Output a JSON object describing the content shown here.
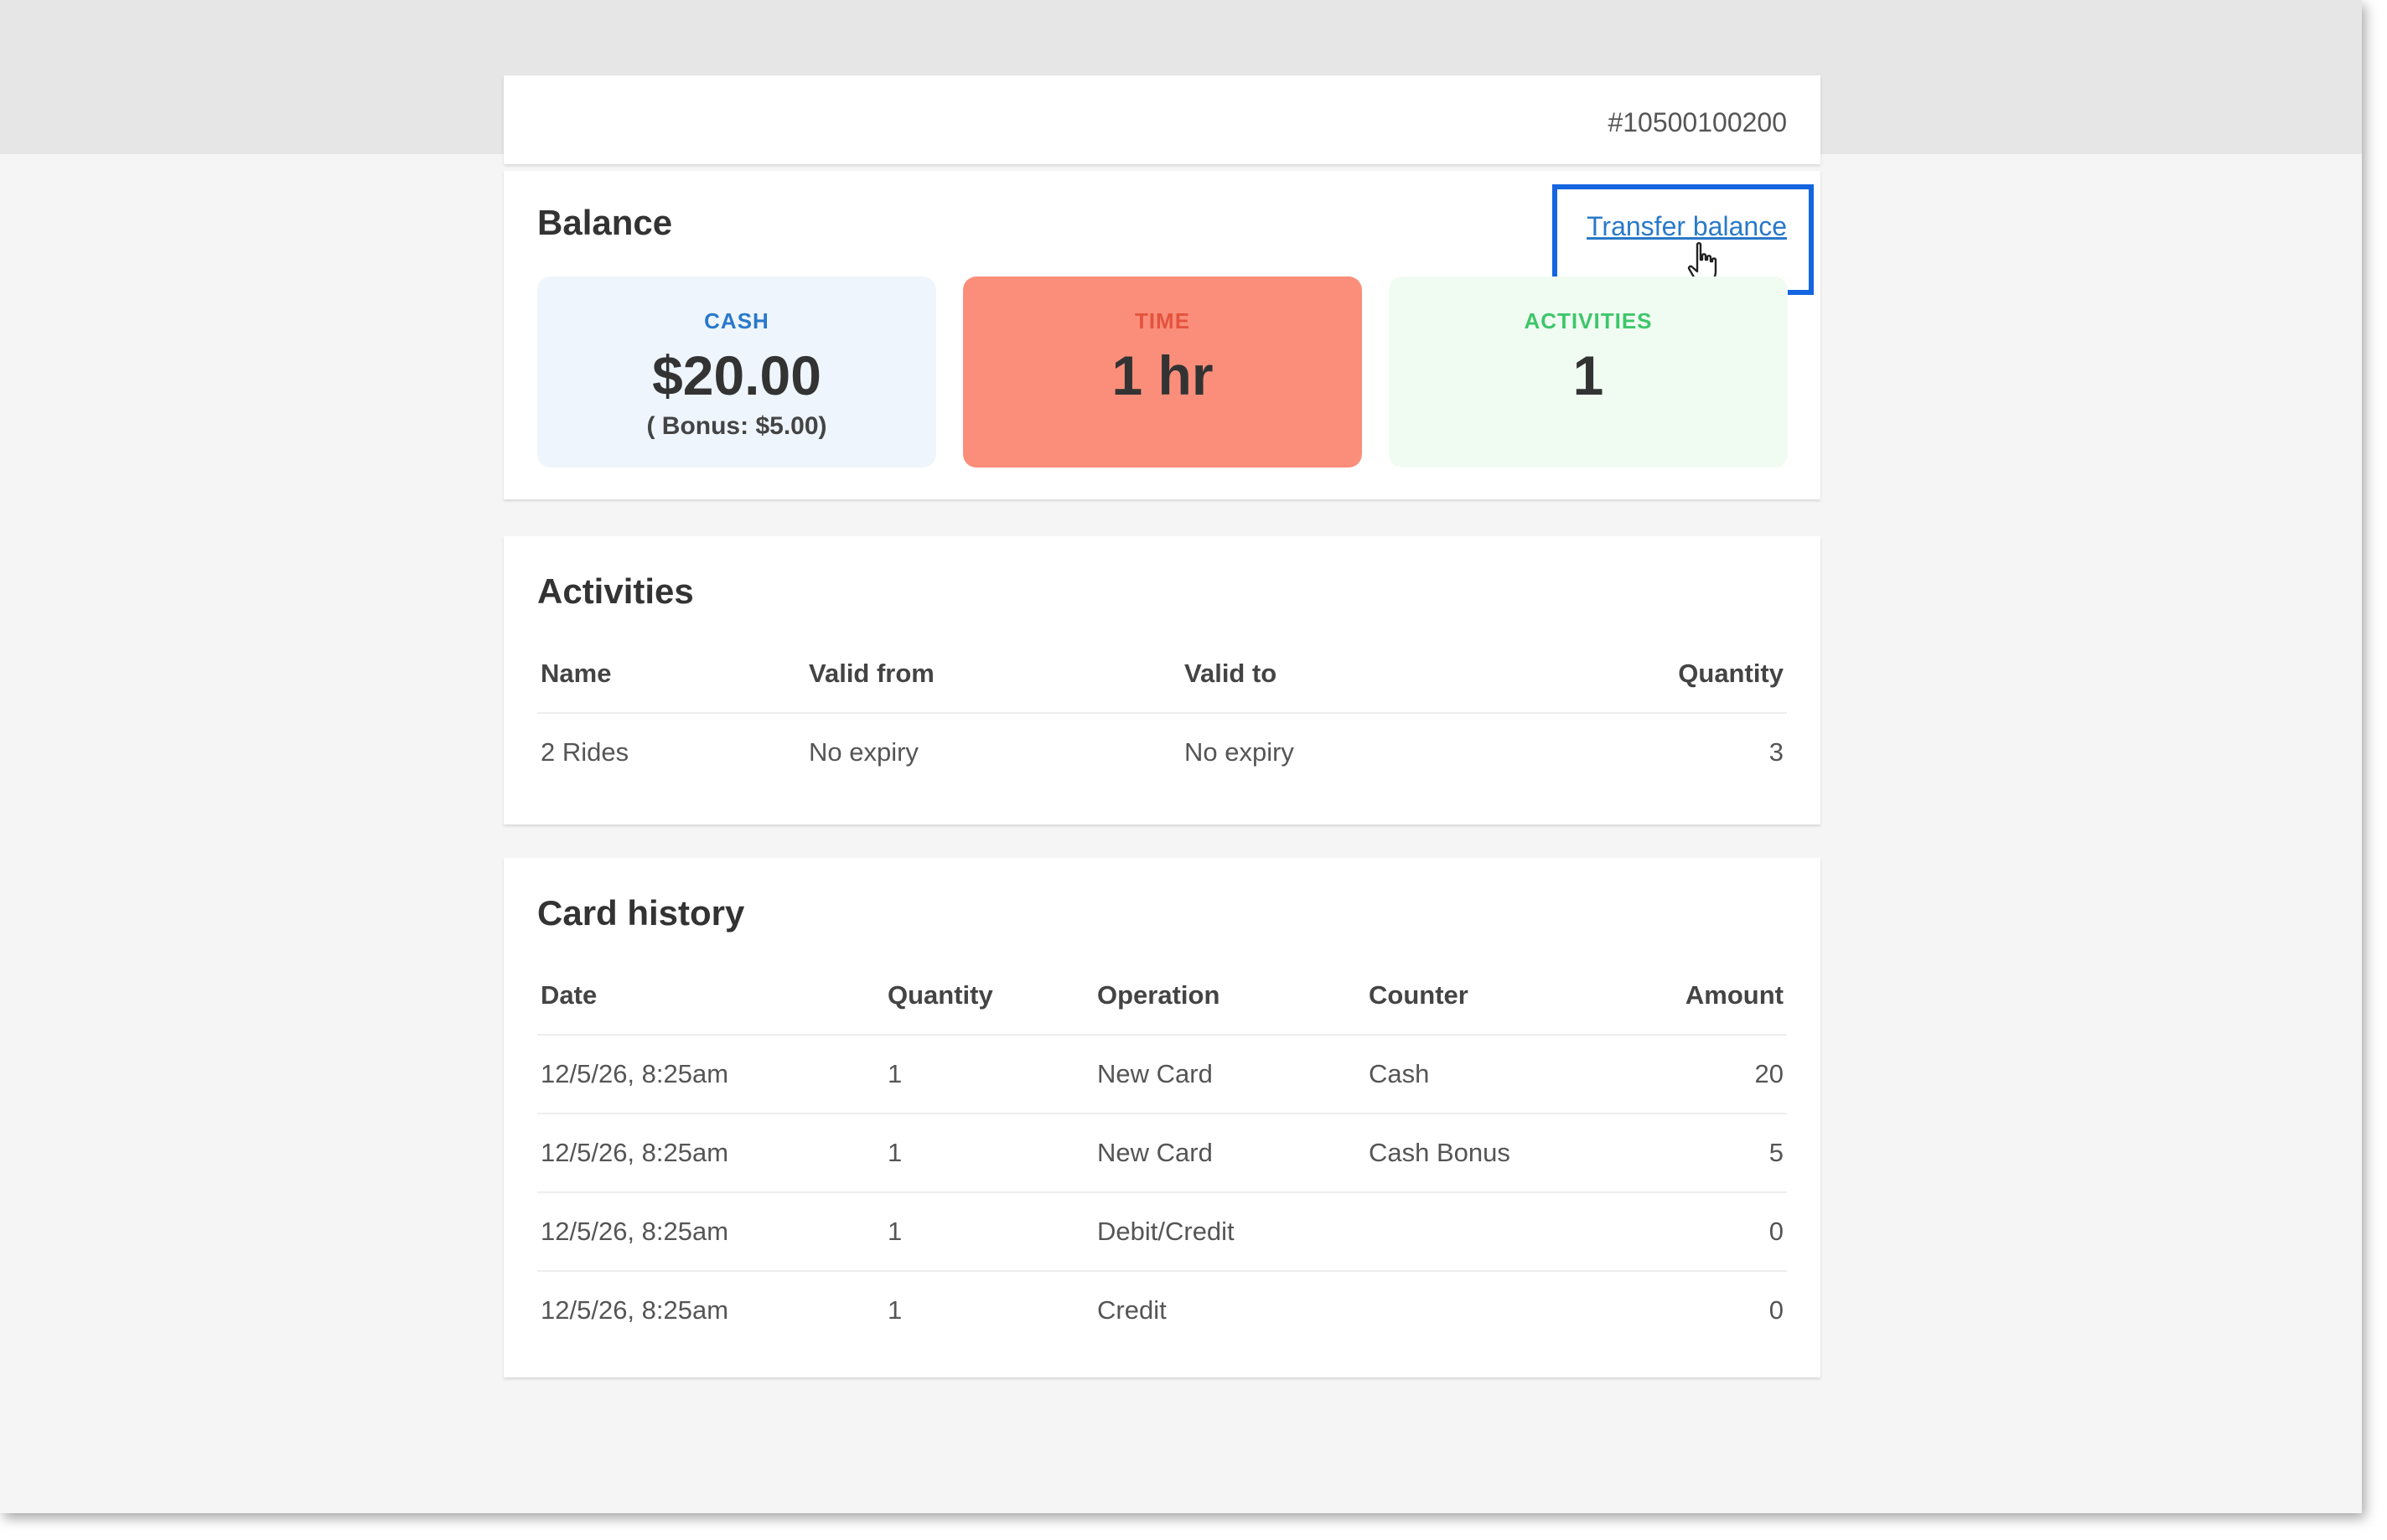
{
  "card_id": "#10500100200",
  "balance": {
    "title": "Balance",
    "transfer_link": "Transfer balance",
    "tiles": {
      "cash": {
        "label": "CASH",
        "value": "$20.00",
        "bonus": "( Bonus: $5.00)"
      },
      "time": {
        "label": "TIME",
        "value": "1 hr"
      },
      "activities": {
        "label": "ACTIVITIES",
        "value": "1"
      }
    },
    "colors": {
      "cash_accent": "#2979c9",
      "time_bg": "#fa8e7a",
      "time_accent": "#e4533d",
      "activities_accent": "#3ec66a",
      "highlight": "#1565e0"
    }
  },
  "activities": {
    "title": "Activities",
    "headers": [
      "Name",
      "Valid from",
      "Valid to",
      "Quantity"
    ],
    "rows": [
      [
        "2 Rides",
        "No expiry",
        "No expiry",
        "3"
      ]
    ]
  },
  "history": {
    "title": "Card history",
    "headers": [
      "Date",
      "Quantity",
      "Operation",
      "Counter",
      "Amount"
    ],
    "rows": [
      [
        "12/5/26, 8:25am",
        "1",
        "New Card",
        "Cash",
        "20"
      ],
      [
        "12/5/26, 8:25am",
        "1",
        "New Card",
        "Cash Bonus",
        "5"
      ],
      [
        "12/5/26, 8:25am",
        "1",
        "Debit/Credit",
        "",
        "0"
      ],
      [
        "12/5/26, 8:25am",
        "1",
        "Credit",
        "",
        "0"
      ]
    ]
  },
  "icons": {
    "cursor": "hand-pointer-icon"
  }
}
